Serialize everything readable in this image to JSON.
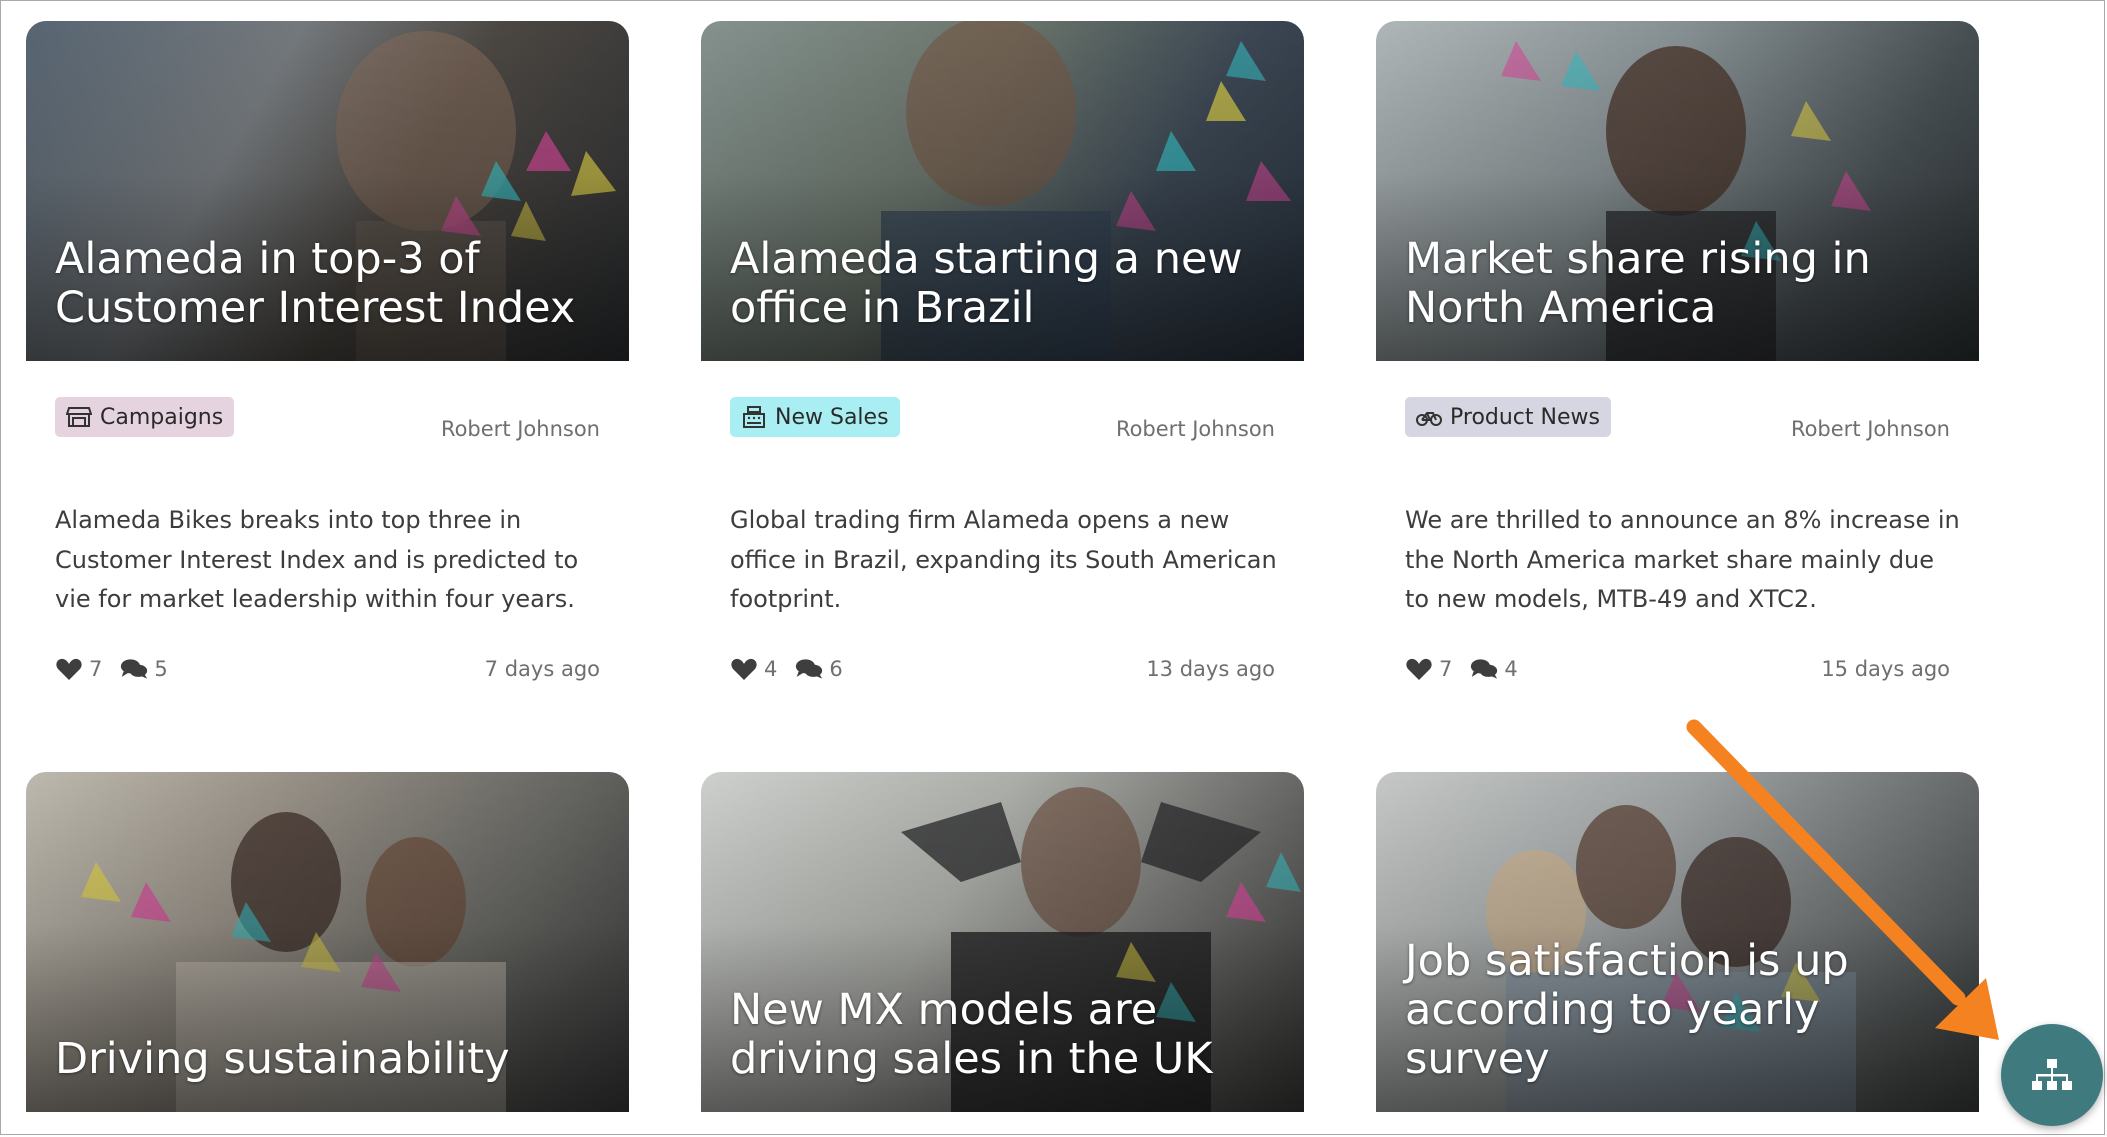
{
  "cards": [
    {
      "title": "Alameda in top-3 of Customer Interest Index",
      "tag": "Campaigns",
      "tag_icon": "store-icon",
      "tag_color": "#e6d3e0",
      "author": "Robert Johnson",
      "excerpt": "Alameda Bikes breaks into top three in Customer Interest Index and is predicted to vie for market leadership within four years.",
      "likes": "7",
      "comments": "5",
      "ago": "7 days ago"
    },
    {
      "title": "Alameda starting a new office in Brazil",
      "tag": "New Sales",
      "tag_icon": "cash-register-icon",
      "tag_color": "#a9eef3",
      "author": "Robert Johnson",
      "excerpt": "Global trading firm Alameda opens a new office in Brazil, expanding its South American footprint.",
      "likes": "4",
      "comments": "6",
      "ago": "13 days ago"
    },
    {
      "title": "Market share rising in North America",
      "tag": "Product News",
      "tag_icon": "bicycle-icon",
      "tag_color": "#d5d6e2",
      "author": "Robert Johnson",
      "excerpt": "We are thrilled to announce an 8% increase in the North America market share mainly due to new models, MTB-49 and XTC2.",
      "likes": "7",
      "comments": "4",
      "ago": "15 days ago"
    },
    {
      "title": "Driving sustainability"
    },
    {
      "title": "New MX models are driving sales in the UK"
    },
    {
      "title": "Job satisfaction is up according to yearly survey"
    }
  ],
  "fab_icon": "sitemap-icon",
  "annotation": {
    "arrow_color": "#f58220"
  }
}
